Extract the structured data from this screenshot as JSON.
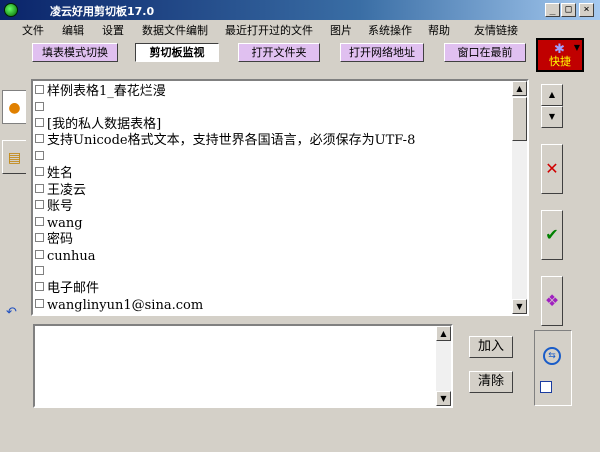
{
  "window": {
    "title": "凌云好用剪切板17.0"
  },
  "menu": [
    "文件",
    "编辑",
    "设置",
    "数据文件编制",
    "最近打开过的文件",
    "图片",
    "系统操作",
    "帮助",
    "友情链接"
  ],
  "toolbar": {
    "buttons": [
      {
        "label": "填表模式切换",
        "active": false
      },
      {
        "label": "剪切板监视",
        "active": true
      },
      {
        "label": "打开文件夹",
        "active": false
      },
      {
        "label": "打开网络地址",
        "active": false
      },
      {
        "label": "窗口在最前",
        "active": false
      }
    ],
    "quick_label": "快捷"
  },
  "list": {
    "items": [
      "样例表格1_春花烂漫",
      "",
      "[我的私人数据表格]",
      "支持Unicode格式文本，支持世界各国语言，必须保存为UTF-8",
      "",
      "姓名",
      "王凌云",
      "账号",
      "wang",
      "密码",
      "cunhua",
      "",
      "电子邮件",
      "wanglinyun1@sina.com"
    ]
  },
  "input": {
    "value": ""
  },
  "buttons": {
    "add": "加入",
    "clear": "清除"
  },
  "icons": {
    "left_tab_1": "orange-fruit-icon",
    "left_tab_2": "book-stack-icon",
    "right_delete": "red-x-icon",
    "right_confirm": "green-check-icon",
    "right_gift": "purple-gift-icon",
    "right_refresh": "blue-refresh-icon"
  }
}
